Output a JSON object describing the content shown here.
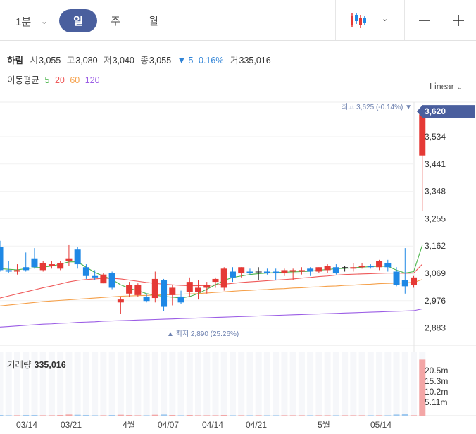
{
  "toolbar": {
    "period_select": "1분",
    "tabs": [
      "일",
      "주",
      "월"
    ],
    "active_tab": "일"
  },
  "info": {
    "stock_name": "하림",
    "open_label": "시",
    "open": "3,055",
    "high_label": "고",
    "high": "3,080",
    "low_label": "저",
    "low": "3,040",
    "close_label": "종",
    "close": "3,055",
    "change": "▼ 5 -0.16%",
    "volume_label": "거",
    "volume": "335,016"
  },
  "ma": {
    "label": "이동평균",
    "periods": [
      "5",
      "20",
      "60",
      "120"
    ],
    "colors": [
      "#4cb54c",
      "#ef5a5a",
      "#f5a04a",
      "#9b5de5"
    ]
  },
  "scale": {
    "label": "Linear"
  },
  "chart_data": {
    "type": "candlestick",
    "up_color": "#e53935",
    "down_color": "#1e88e5",
    "y_ticks": [
      "3,162",
      "3,069",
      "2,976",
      "2,883"
    ],
    "y_ticks_upper": [
      "3,534",
      "3,441",
      "3,348",
      "3,255"
    ],
    "y_tick_values": [
      3534,
      3441,
      3348,
      3255,
      3162,
      3069,
      2976,
      2883
    ],
    "current_price": "3,620",
    "current_price_value": 3620,
    "high_annotation": "최고 3,625 (-0.14%) ▼",
    "low_annotation": "▲ 최저 2,890 (25.26%)",
    "x_labels": [
      "03/14",
      "03/21",
      "4월",
      "04/07",
      "04/14",
      "04/21",
      "5월",
      "05/14"
    ],
    "candles": [
      [
        3160,
        3180,
        3075,
        3080
      ],
      [
        3080,
        3110,
        3070,
        3075
      ],
      [
        3075,
        3100,
        3065,
        3080
      ],
      [
        3090,
        3140,
        3075,
        3080
      ],
      [
        3120,
        3155,
        3085,
        3090
      ],
      [
        3080,
        3110,
        3075,
        3105
      ],
      [
        3095,
        3110,
        3085,
        3100
      ],
      [
        3085,
        3110,
        3080,
        3105
      ],
      [
        3110,
        3165,
        3095,
        3120
      ],
      [
        3150,
        3160,
        3085,
        3100
      ],
      [
        3090,
        3100,
        3050,
        3060
      ],
      [
        3060,
        3080,
        3045,
        3055
      ],
      [
        3035,
        3070,
        3035,
        3065
      ],
      [
        3070,
        3075,
        3015,
        3020
      ],
      [
        2970,
        2990,
        2930,
        2980
      ],
      [
        3000,
        3040,
        2990,
        3030
      ],
      [
        2995,
        3035,
        2990,
        3030
      ],
      [
        2990,
        3000,
        2970,
        2975
      ],
      [
        2985,
        3075,
        2970,
        3050
      ],
      [
        3045,
        3050,
        2940,
        2955
      ],
      [
        2995,
        3030,
        2960,
        3020
      ],
      [
        2990,
        3010,
        2965,
        2970
      ],
      [
        3005,
        3055,
        2990,
        3040
      ],
      [
        3005,
        3045,
        2980,
        3020
      ],
      [
        3020,
        3040,
        3000,
        3030
      ],
      [
        3040,
        3055,
        3020,
        3050
      ],
      [
        3020,
        3090,
        3010,
        3085
      ],
      [
        3075,
        3090,
        3040,
        3055
      ],
      [
        3070,
        3090,
        3055,
        3090
      ],
      [
        3075,
        3085,
        3065,
        3070
      ],
      [
        3075,
        3090,
        3045,
        3075
      ],
      [
        3075,
        3085,
        3065,
        3070
      ],
      [
        3075,
        3085,
        3045,
        3070
      ],
      [
        3070,
        3085,
        3060,
        3080
      ],
      [
        3075,
        3085,
        3045,
        3080
      ],
      [
        3075,
        3090,
        3065,
        3080
      ],
      [
        3085,
        3090,
        3060,
        3075
      ],
      [
        3075,
        3090,
        3070,
        3090
      ],
      [
        3080,
        3100,
        3070,
        3095
      ],
      [
        3090,
        3100,
        3065,
        3070
      ],
      [
        3090,
        3095,
        3075,
        3090
      ],
      [
        3085,
        3105,
        3075,
        3090
      ],
      [
        3090,
        3105,
        3085,
        3095
      ],
      [
        3095,
        3100,
        3085,
        3090
      ],
      [
        3090,
        3115,
        3080,
        3110
      ],
      [
        3105,
        3115,
        3075,
        3090
      ],
      [
        3075,
        3090,
        3025,
        3030
      ],
      [
        3045,
        3155,
        3000,
        3025
      ],
      [
        3030,
        3060,
        3020,
        3055
      ],
      [
        3470,
        3625,
        3280,
        3610
      ]
    ],
    "ma5": [
      3085,
      3083,
      3081,
      3085,
      3088,
      3090,
      3094,
      3100,
      3108,
      3108,
      3090,
      3072,
      3060,
      3048,
      3030,
      3018,
      3010,
      3000,
      2995,
      2990,
      2988,
      2985,
      2990,
      3000,
      3015,
      3030,
      3045,
      3055,
      3060,
      3065,
      3068,
      3070,
      3072,
      3073,
      3074,
      3075,
      3076,
      3080,
      3082,
      3085,
      3086,
      3088,
      3090,
      3092,
      3093,
      3093,
      3080,
      3070,
      3075,
      3165
    ],
    "ma20": [
      2985,
      2992,
      2999,
      3006,
      3013,
      3020,
      3026,
      3033,
      3040,
      3045,
      3048,
      3050,
      3052,
      3052,
      3050,
      3046,
      3042,
      3038,
      3035,
      3032,
      3030,
      3028,
      3027,
      3027,
      3028,
      3030,
      3032,
      3035,
      3038,
      3040,
      3042,
      3044,
      3046,
      3048,
      3050,
      3053,
      3055,
      3058,
      3060,
      3063,
      3065,
      3066,
      3067,
      3068,
      3069,
      3070,
      3070,
      3069,
      3070,
      3100
    ],
    "ma60": [
      2958,
      2961,
      2964,
      2967,
      2970,
      2973,
      2975,
      2977,
      2979,
      2981,
      2983,
      2985,
      2987,
      2989,
      2991,
      2992,
      2993,
      2994,
      2995,
      2996,
      2997,
      2998,
      2999,
      3000,
      3002,
      3004,
      3006,
      3008,
      3010,
      3011,
      3013,
      3014,
      3016,
      3017,
      3019,
      3020,
      3022,
      3023,
      3025,
      3026,
      3028,
      3029,
      3031,
      3032,
      3034,
      3035,
      3036,
      3037,
      3038,
      3048
    ],
    "ma120": [
      2886,
      2888,
      2890,
      2892,
      2894,
      2896,
      2897,
      2899,
      2900,
      2902,
      2903,
      2904,
      2906,
      2907,
      2908,
      2909,
      2910,
      2911,
      2912,
      2913,
      2914,
      2915,
      2916,
      2917,
      2918,
      2919,
      2920,
      2921,
      2922,
      2923,
      2924,
      2925,
      2926,
      2927,
      2928,
      2929,
      2930,
      2931,
      2932,
      2933,
      2934,
      2935,
      2936,
      2937,
      2938,
      2939,
      2940,
      2941,
      2942,
      2948
    ],
    "volume_label": "거래량",
    "volume_value": "335,016",
    "volume_ticks": [
      "20.5m",
      "15.3m",
      "10.2m",
      "5.11m"
    ],
    "volume_tick_values": [
      20.5,
      15.3,
      10.2,
      5.11
    ],
    "volumes": [
      0.3,
      0.2,
      0.2,
      0.3,
      0.3,
      0.2,
      0.2,
      0.3,
      0.5,
      0.4,
      0.3,
      0.2,
      0.2,
      0.3,
      0.4,
      0.3,
      0.2,
      0.2,
      0.4,
      0.5,
      0.3,
      0.2,
      0.3,
      0.2,
      0.2,
      0.2,
      0.3,
      0.2,
      0.2,
      0.2,
      0.2,
      0.2,
      0.2,
      0.2,
      0.2,
      0.2,
      0.2,
      0.2,
      0.2,
      0.2,
      0.2,
      0.2,
      0.2,
      0.2,
      0.2,
      0.2,
      0.5,
      0.6,
      0.2,
      24.0
    ]
  }
}
